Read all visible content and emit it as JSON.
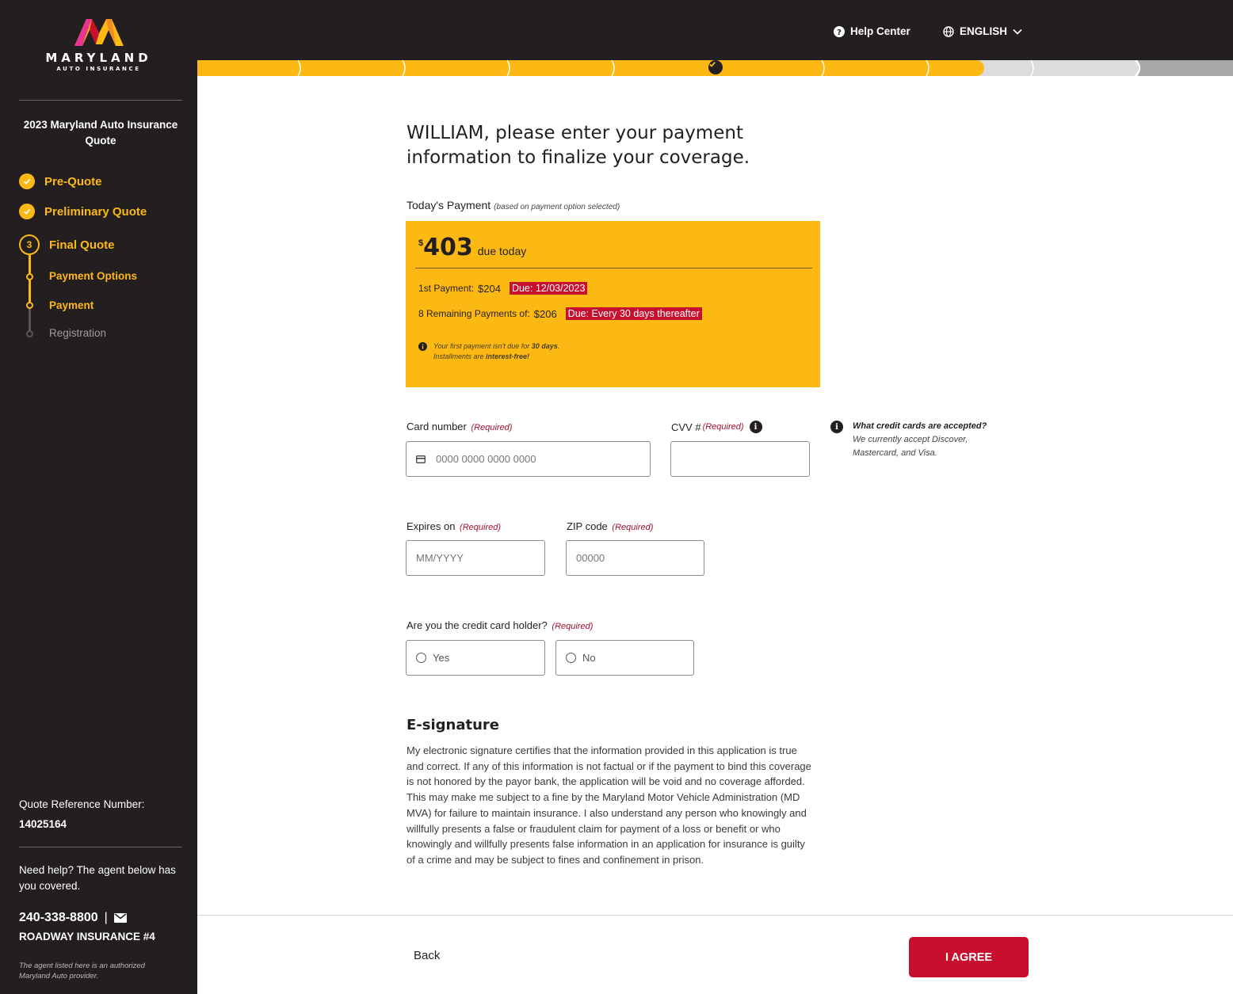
{
  "brand": {
    "name": "MARYLAND",
    "tagline": "AUTO INSURANCE",
    "colors": {
      "dark": "#231f20",
      "yellow": "#fdb913",
      "red": "#c8102e"
    }
  },
  "sidebar": {
    "quote_title": "2023 Maryland Auto Insurance Quote",
    "steps": [
      {
        "label": "Pre-Quote",
        "status": "complete"
      },
      {
        "label": "Preliminary Quote",
        "status": "complete"
      },
      {
        "label": "Final Quote",
        "number": "3",
        "status": "current"
      }
    ],
    "substeps": [
      {
        "label": "Payment Options",
        "status": "complete"
      },
      {
        "label": "Payment",
        "status": "current"
      },
      {
        "label": "Registration",
        "status": "inactive"
      }
    ],
    "reference_label": "Quote Reference Number:",
    "reference_number": "14025164",
    "help_text": "Need help? The agent below has you covered.",
    "agent_phone": "240-338-8800",
    "agent_separator": "|",
    "agent_name": "ROADWAY INSURANCE #4",
    "agent_note": "The agent listed here is an authorized Maryland Auto provider."
  },
  "header": {
    "help_center": "Help Center",
    "language": "ENGLISH"
  },
  "progress": {
    "fraction_complete": 0.76
  },
  "main": {
    "headline": "WILLIAM, please enter your payment information to finalize your coverage.",
    "todays_payment_label": "Today's Payment",
    "todays_payment_note": "(based on payment option selected)",
    "amount_symbol": "$",
    "amount": "403",
    "amount_suffix": "due today",
    "first_payment_label": "1st Payment:",
    "first_payment_value": "$204",
    "first_payment_due": "Due: 12/03/2023",
    "remaining_label": "8 Remaining Payments of:",
    "remaining_value": "$206",
    "remaining_due": "Due: Every 30 days thereafter",
    "note_line1_a": "Your first payment isn't due for ",
    "note_line1_b": "30 days",
    "note_line1_c": ".",
    "note_line2_a": "Installments are ",
    "note_line2_b": "interest-free!",
    "card_number_label": "Card number",
    "card_number_placeholder": "0000 0000 0000 0000",
    "cvv_label": "CVV #",
    "required": "(Required)",
    "cc_question": "What credit cards are accepted?",
    "cc_answer": "We currently accept Discover, Mastercard, and Visa.",
    "expires_label": "Expires on",
    "expires_placeholder": "MM/YYYY",
    "zip_label": "ZIP code",
    "zip_placeholder": "00000",
    "holder_question": "Are you the credit card holder?",
    "holder_yes": "Yes",
    "holder_no": "No",
    "esig_title": "E-signature",
    "esig_text": "My electronic signature certifies that the information provided in this application is true and correct. If any of this information is not factual or if the payment to bind this coverage is not honored by the payor bank, the application will be void and no coverage afforded. This may make me subject to a fine by the Maryland Motor Vehicle Administration (MD MVA) for failure to maintain insurance. I also understand any person who knowingly and willfully presents a false or fraudulent claim for payment of a loss or benefit or who knowingly and willfully presents false information in an application for insurance is guilty of a crime and may be subject to fines and confinement in prison."
  },
  "footer": {
    "back": "Back",
    "agree": "I AGREE"
  }
}
